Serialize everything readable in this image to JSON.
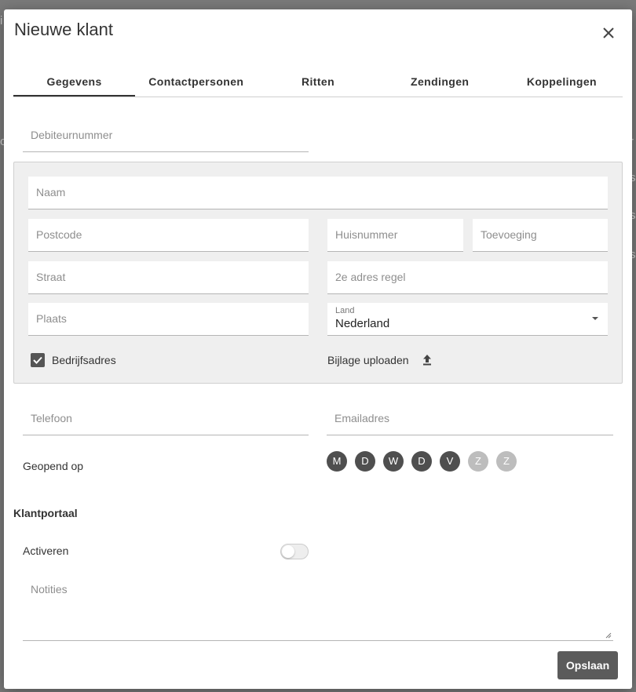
{
  "dialog": {
    "title": "Nieuwe klant"
  },
  "tabs": [
    {
      "label": "Gegevens",
      "active": true
    },
    {
      "label": "Contactpersonen",
      "active": false
    },
    {
      "label": "Ritten",
      "active": false
    },
    {
      "label": "Zendingen",
      "active": false
    },
    {
      "label": "Koppelingen",
      "active": false
    }
  ],
  "fields": {
    "debiteurnummer": {
      "placeholder": "Debiteurnummer",
      "value": ""
    },
    "naam": {
      "placeholder": "Naam",
      "value": ""
    },
    "postcode": {
      "placeholder": "Postcode",
      "value": ""
    },
    "huisnummer": {
      "placeholder": "Huisnummer",
      "value": ""
    },
    "toevoeging": {
      "placeholder": "Toevoeging",
      "value": ""
    },
    "straat": {
      "placeholder": "Straat",
      "value": ""
    },
    "adres_regel_2": {
      "placeholder": "2e adres regel",
      "value": ""
    },
    "plaats": {
      "placeholder": "Plaats",
      "value": ""
    },
    "land": {
      "label": "Land",
      "value": "Nederland"
    },
    "telefoon": {
      "placeholder": "Telefoon",
      "value": ""
    },
    "emailadres": {
      "placeholder": "Emailadres",
      "value": ""
    },
    "notities": {
      "placeholder": "Notities",
      "value": ""
    }
  },
  "bedrijfsadres": {
    "label": "Bedrijfsadres",
    "checked": true
  },
  "bijlage": {
    "label": "Bijlage uploaden",
    "icon": "upload-icon"
  },
  "opening": {
    "label": "Geopend op",
    "days": [
      {
        "letter": "M",
        "active": true
      },
      {
        "letter": "D",
        "active": true
      },
      {
        "letter": "W",
        "active": true
      },
      {
        "letter": "D",
        "active": true
      },
      {
        "letter": "V",
        "active": true
      },
      {
        "letter": "Z",
        "active": false
      },
      {
        "letter": "Z",
        "active": false
      }
    ]
  },
  "klantportaal": {
    "title": "Klantportaal",
    "activeren_label": "Activeren",
    "activeren_enabled": false
  },
  "actions": {
    "save_label": "Opslaan"
  },
  "colors": {
    "active_day": "#4f4f4f",
    "inactive_day": "#bdbdbd",
    "save_button": "#5b5b5b"
  }
}
